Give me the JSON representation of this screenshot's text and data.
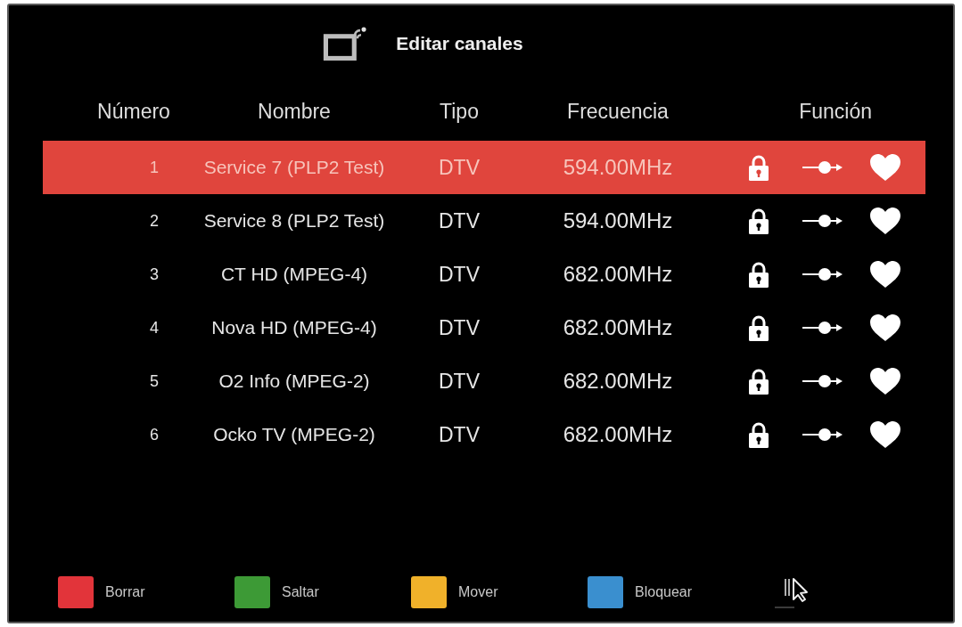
{
  "title": "Editar canales",
  "columns": [
    "Número",
    "Nombre",
    "Tipo",
    "Frecuencia",
    "Función"
  ],
  "channels": [
    {
      "number": "1",
      "name": "Service 7 (PLP2 Test)",
      "type": "DTV",
      "frequency": "594.00MHz",
      "selected": true
    },
    {
      "number": "2",
      "name": "Service 8 (PLP2 Test)",
      "type": "DTV",
      "frequency": "594.00MHz",
      "selected": false
    },
    {
      "number": "3",
      "name": "CT HD (MPEG-4)",
      "type": "DTV",
      "frequency": "682.00MHz",
      "selected": false
    },
    {
      "number": "4",
      "name": "Nova HD (MPEG-4)",
      "type": "DTV",
      "frequency": "682.00MHz",
      "selected": false
    },
    {
      "number": "5",
      "name": "O2 Info (MPEG-2)",
      "type": "DTV",
      "frequency": "682.00MHz",
      "selected": false
    },
    {
      "number": "6",
      "name": "Ocko TV (MPEG-2)",
      "type": "DTV",
      "frequency": "682.00MHz",
      "selected": false
    }
  ],
  "legend": [
    {
      "label": "Borrar",
      "color": "#e2343a"
    },
    {
      "label": "Saltar",
      "color": "#3d9a36"
    },
    {
      "label": "Mover",
      "color": "#f0b12a"
    },
    {
      "label": "Bloquear",
      "color": "#3a8fcf"
    }
  ]
}
